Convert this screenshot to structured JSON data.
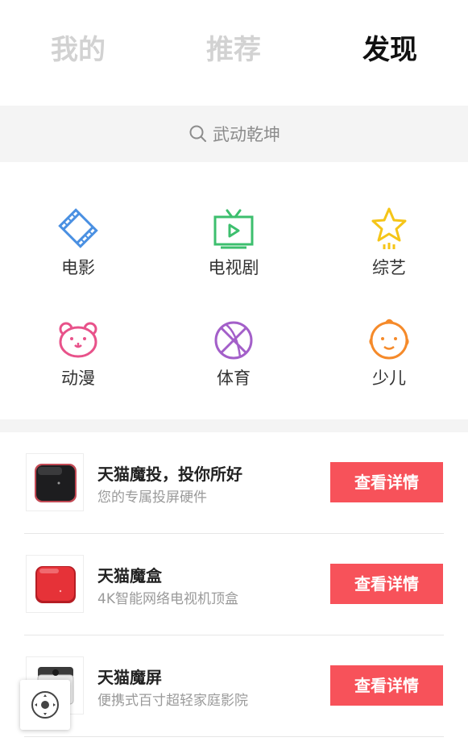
{
  "tabs": [
    {
      "label": "我的",
      "active": false
    },
    {
      "label": "推荐",
      "active": false
    },
    {
      "label": "发现",
      "active": true
    }
  ],
  "search": {
    "placeholder": "武动乾坤",
    "icon": "search-icon"
  },
  "categories": [
    {
      "label": "电影",
      "icon": "film-icon",
      "color": "#4a90e2"
    },
    {
      "label": "电视剧",
      "icon": "tv-icon",
      "color": "#3dbf6e"
    },
    {
      "label": "综艺",
      "icon": "star-icon",
      "color": "#f5c518"
    },
    {
      "label": "动漫",
      "icon": "bear-icon",
      "color": "#e8528a"
    },
    {
      "label": "体育",
      "icon": "basketball-icon",
      "color": "#a35fc9"
    },
    {
      "label": "少儿",
      "icon": "baby-face-icon",
      "color": "#f58a2a"
    }
  ],
  "products": [
    {
      "title": "天猫魔投，投你所好",
      "subtitle": "您的专属投屏硬件",
      "button": "查看详情",
      "icon": "projector-icon"
    },
    {
      "title": "天猫魔盒",
      "subtitle": "4K智能网络电视机顶盒",
      "button": "查看详情",
      "icon": "tv-box-icon"
    },
    {
      "title": "天猫魔屏",
      "subtitle": "便携式百寸超轻家庭影院",
      "button": "查看详情",
      "icon": "portable-projector-icon"
    }
  ],
  "colors": {
    "accent_button": "#f7525a",
    "active_tab": "#111111",
    "inactive_tab": "#d2d2d2"
  },
  "floating_button": {
    "icon": "remote-control-icon"
  }
}
